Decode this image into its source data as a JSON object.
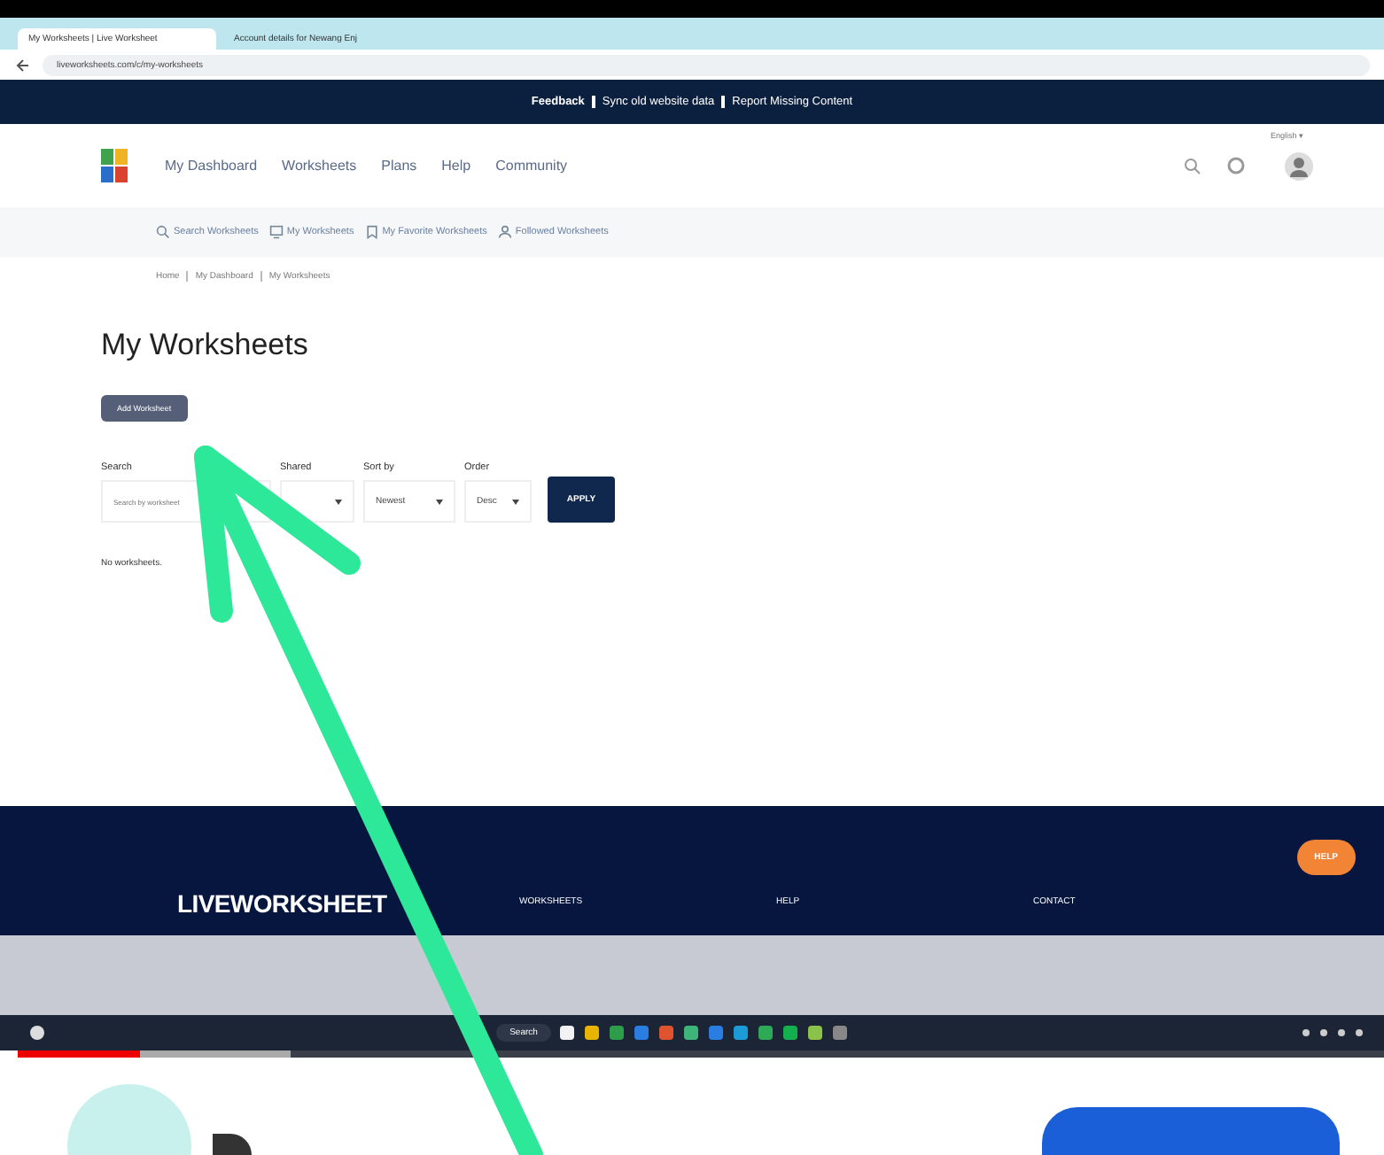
{
  "browser": {
    "tabs": [
      {
        "title": "My Worksheets | Live Worksheet",
        "selected": true
      },
      {
        "title": "Account details for Newang Enj",
        "selected": false
      }
    ],
    "url": "liveworksheets.com/c/my-worksheets"
  },
  "banner": {
    "links": [
      "Feedback",
      "Sync old website data",
      "Report Missing Content"
    ]
  },
  "nav": {
    "items": [
      "My Dashboard",
      "Worksheets",
      "Plans",
      "Help",
      "Community"
    ],
    "language": "English ▾"
  },
  "subnav": [
    {
      "kind": "search",
      "label": "Search Worksheets"
    },
    {
      "kind": "monitor",
      "label": "My Worksheets"
    },
    {
      "kind": "bookmark",
      "label": "My Favorite Worksheets"
    },
    {
      "kind": "person",
      "label": "Followed Worksheets"
    }
  ],
  "breadcrumb": [
    "Home",
    "My Dashboard",
    "My Worksheets"
  ],
  "title": "My Worksheets",
  "add_button": "Add Worksheet",
  "filters": {
    "search_label": "Search",
    "search_placeholder": "Search by worksheet",
    "shared_label": "Shared",
    "sort_label": "Sort by",
    "sort_value": "Newest",
    "order_label": "Order",
    "order_value": "Desc",
    "apply": "APPLY"
  },
  "empty_text": "No worksheets.",
  "footer": {
    "logo": "LIVEWORKSHEET",
    "columns": [
      "WORKSHEETS",
      "HELP",
      "CONTACT"
    ],
    "help_button": "HELP"
  },
  "taskbar": {
    "search": "Search"
  },
  "video": {
    "level": 0.09
  }
}
